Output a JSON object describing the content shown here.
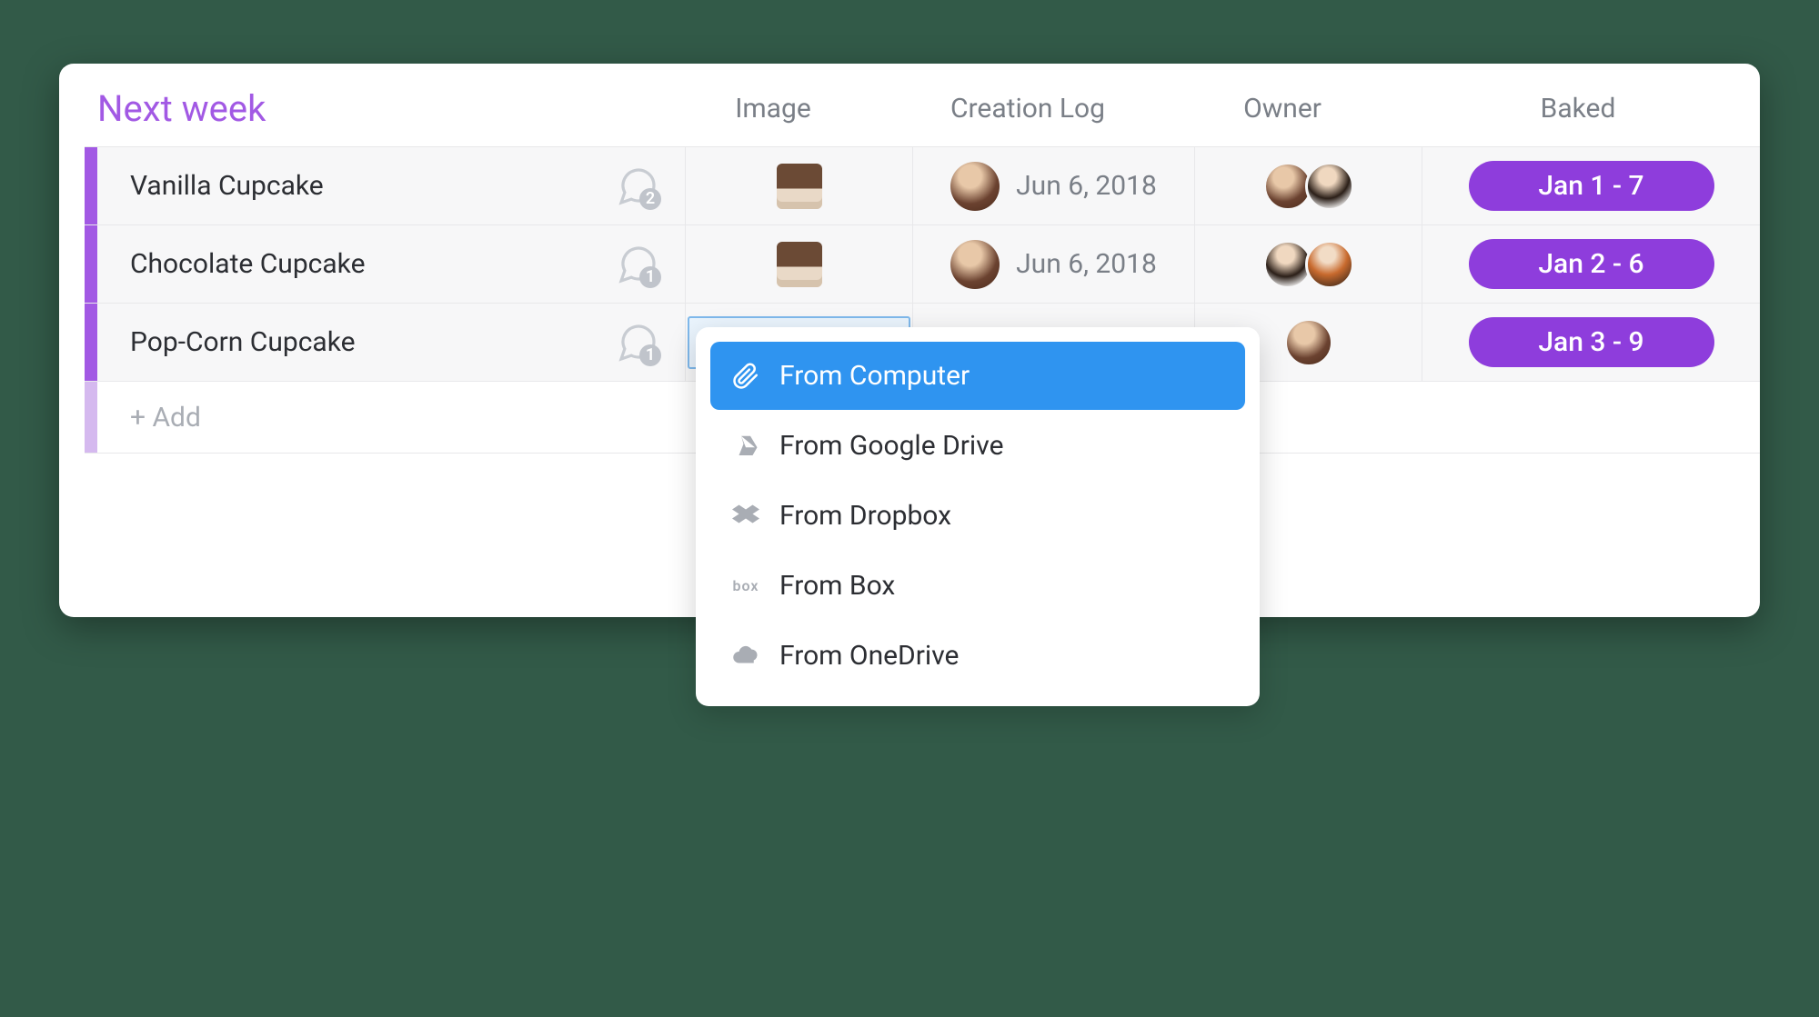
{
  "group": {
    "title": "Next week",
    "columns": {
      "image": "Image",
      "creation_log": "Creation Log",
      "owner": "Owner",
      "baked": "Baked"
    },
    "rows": [
      {
        "name": "Vanilla Cupcake",
        "comment_count": "2",
        "creation_date": "Jun 6, 2018",
        "baked": "Jan 1 - 7"
      },
      {
        "name": "Chocolate Cupcake",
        "comment_count": "1",
        "creation_date": "Jun 6, 2018",
        "baked": "Jan 2 - 6"
      },
      {
        "name": "Pop-Corn Cupcake",
        "comment_count": "1",
        "baked": "Jan 3 - 9"
      }
    ],
    "add_label": "+ Add"
  },
  "upload_menu": {
    "items": [
      {
        "label": "From Computer",
        "icon": "paperclip",
        "selected": true
      },
      {
        "label": "From Google Drive",
        "icon": "gdrive"
      },
      {
        "label": "From Dropbox",
        "icon": "dropbox"
      },
      {
        "label": "From Box",
        "icon": "box"
      },
      {
        "label": "From OneDrive",
        "icon": "onedrive"
      }
    ]
  },
  "colors": {
    "accent": "#a259e4",
    "baked_pill": "#8e3ddc",
    "menu_highlight": "#2f94f0"
  }
}
